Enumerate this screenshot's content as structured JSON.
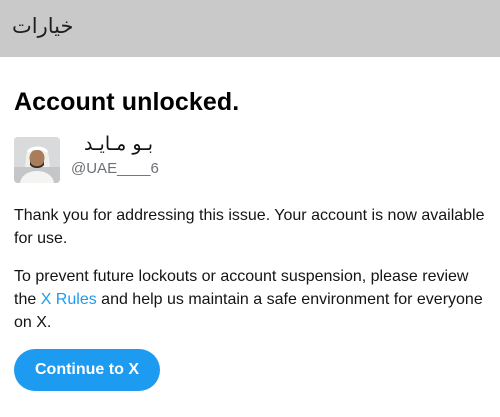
{
  "header": {
    "title": "خيارات"
  },
  "main": {
    "heading": "Account unlocked.",
    "user": {
      "display_name": "بـو مـايـد",
      "handle": "@UAE____6"
    },
    "paragraph1": "Thank you for addressing this issue. Your account is now available for use.",
    "paragraph2": {
      "before_link": "To prevent future lockouts or account suspension, please review the ",
      "link_text": "X Rules",
      "after_link": " and help us maintain a safe environment for everyone on X."
    },
    "continue_button": "Continue to X"
  },
  "colors": {
    "accent": "#1d9bf0",
    "header_bg": "#c9c9c9"
  }
}
